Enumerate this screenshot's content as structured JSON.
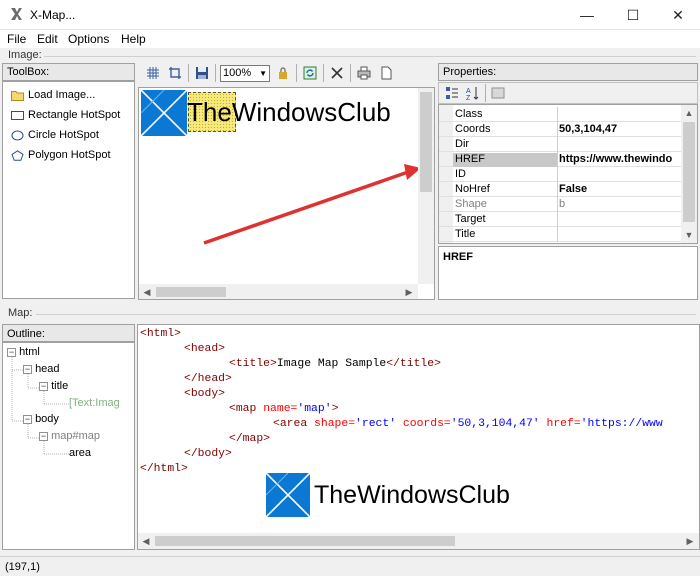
{
  "window": {
    "title": "X-Map...",
    "minimize_glyph": "—",
    "maximize_glyph": "☐",
    "close_glyph": "✕"
  },
  "menu": [
    "File",
    "Edit",
    "Options",
    "Help"
  ],
  "image_group": {
    "label": "Image:"
  },
  "toolbox": {
    "header": "ToolBox:",
    "items": [
      {
        "label": "Load Image...",
        "icon": "folder-icon"
      },
      {
        "label": "Rectangle HotSpot",
        "icon": "rectangle-icon"
      },
      {
        "label": "Circle HotSpot",
        "icon": "circle-icon"
      },
      {
        "label": "Polygon HotSpot",
        "icon": "polygon-icon"
      }
    ]
  },
  "toolbar": {
    "zoom": "100%"
  },
  "canvas": {
    "logo_text": "TheWindowsClub",
    "logo_prefix": "The",
    "logo_rest": "WindowsClub"
  },
  "properties": {
    "header": "Properties:",
    "rows": [
      {
        "name": "Class",
        "value": ""
      },
      {
        "name": "Coords",
        "value": "50,3,104,47"
      },
      {
        "name": "Dir",
        "value": ""
      },
      {
        "name": "HREF",
        "value": "https://www.thewindo"
      },
      {
        "name": "ID",
        "value": ""
      },
      {
        "name": "NoHref",
        "value": "False"
      },
      {
        "name": "Shape",
        "value": "b"
      },
      {
        "name": "Target",
        "value": ""
      },
      {
        "name": "Title",
        "value": ""
      }
    ],
    "description": "HREF"
  },
  "map_group": {
    "label": "Map:"
  },
  "outline": {
    "header": "Outline:",
    "nodes": {
      "html": "html",
      "head": "head",
      "title": "title",
      "text": "[Text:Imag",
      "body": "body",
      "map": "map#map",
      "area": "area"
    }
  },
  "code": {
    "l1_open": "<html>",
    "l2_open": "<head>",
    "l3_open": "<title>",
    "l3_text": "Image Map Sample",
    "l3_close": "</title>",
    "l4_close": "</head>",
    "l5_open": "<body>",
    "l6_tag": "<map",
    "l6_attr": "name=",
    "l6_val": "'map'",
    "l6_end": ">",
    "l7_tag": "<area",
    "l7_a1": "shape=",
    "l7_v1": "'rect'",
    "l7_a2": "coords=",
    "l7_v2": "'50,3,104,47'",
    "l7_a3": "href=",
    "l7_v3": "'https://www",
    "l8_close": "</map>",
    "l9_close": "</body>",
    "l10_close": "</html>"
  },
  "status": {
    "coords": "(197,1)"
  },
  "colors": {
    "logo_blue": "#0078d7",
    "arrow_red": "#e03131",
    "hotspot_yellow": "#f5e663"
  }
}
